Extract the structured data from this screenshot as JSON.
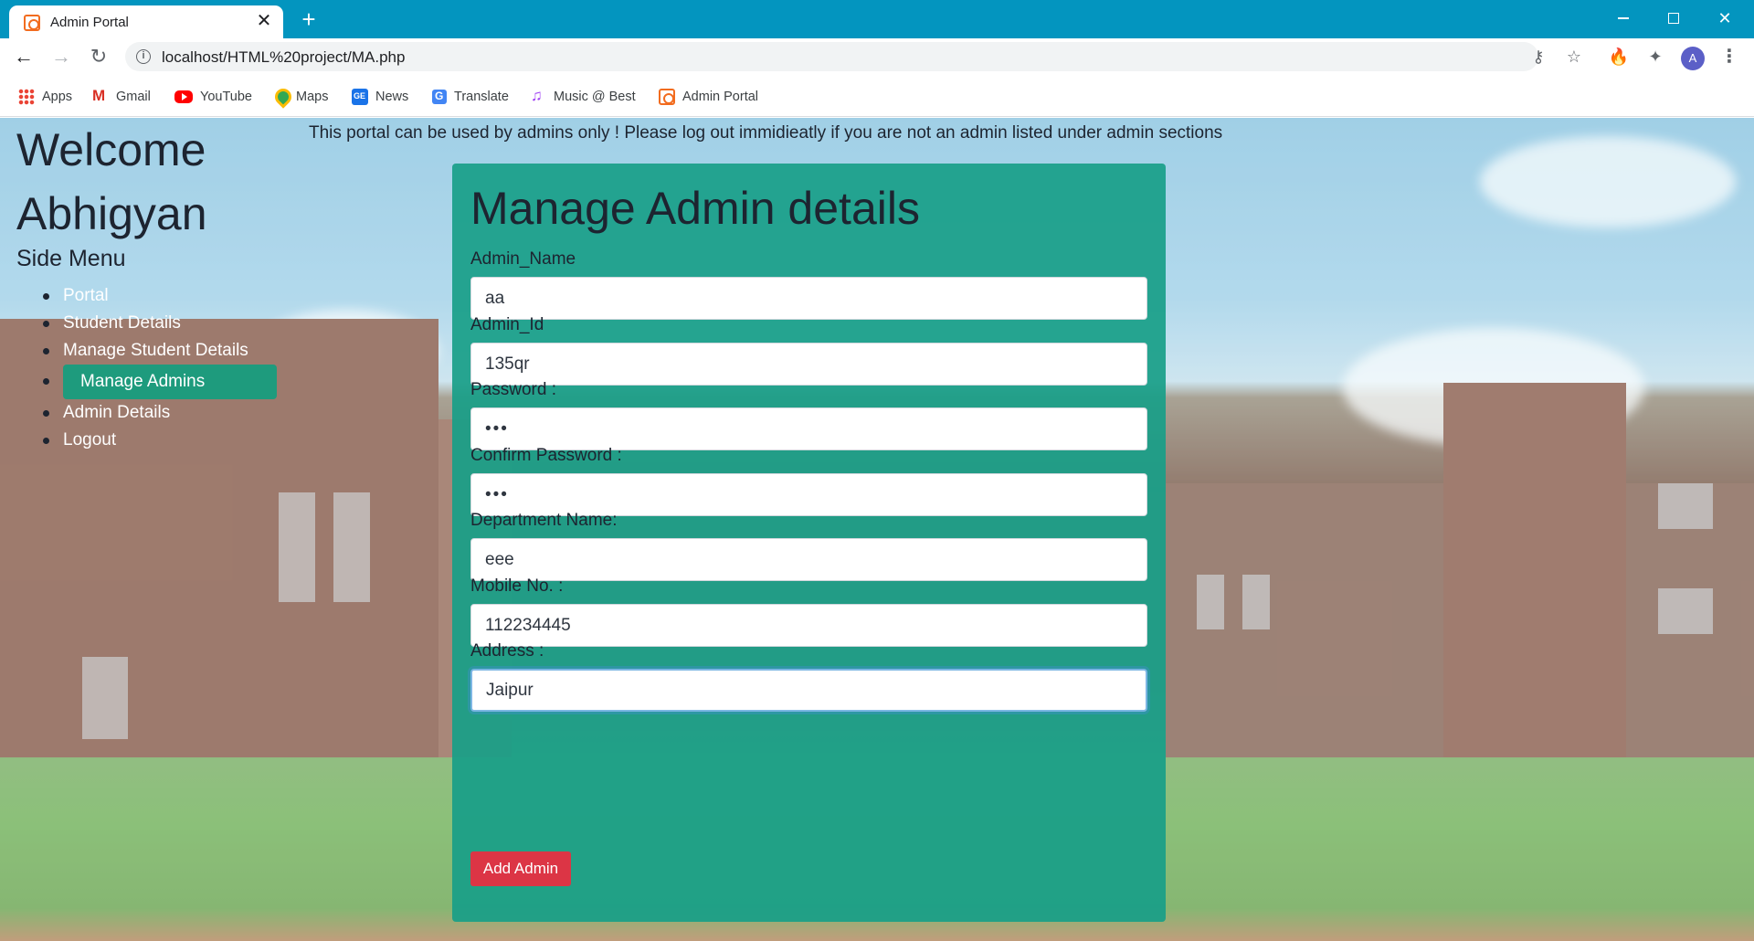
{
  "tab": {
    "title": "Admin Portal",
    "close_glyph": "✕"
  },
  "new_tab_glyph": "+",
  "window_controls": {
    "close_glyph": "✕"
  },
  "toolbar": {
    "back_glyph": "←",
    "forward_glyph": "→",
    "reload_glyph": "↻",
    "url": "localhost/HTML%20project/MA.php",
    "info_glyph": "i",
    "key_glyph": "⚷",
    "star_glyph": "☆",
    "fire_glyph": "🔥",
    "puzzle_glyph": "✦",
    "avatar_letter": "A",
    "menu_glyph": "⋮"
  },
  "bookmarks": [
    {
      "label": "Apps",
      "icon": "apps-icon"
    },
    {
      "label": "Gmail",
      "icon": "gmail-icon"
    },
    {
      "label": "YouTube",
      "icon": "youtube-icon"
    },
    {
      "label": "Maps",
      "icon": "maps-icon"
    },
    {
      "label": "News",
      "icon": "news-icon"
    },
    {
      "label": "Translate",
      "icon": "translate-icon"
    },
    {
      "label": "Music @ Best",
      "icon": "music-icon"
    },
    {
      "label": "Admin Portal",
      "icon": "xampp-icon"
    }
  ],
  "page": {
    "welcome_line1": "Welcome",
    "welcome_line2": "Abhigyan",
    "side_heading": "Side Menu",
    "side_menu": [
      {
        "label": "Portal"
      },
      {
        "label": "Student Details"
      },
      {
        "label": "Manage Student Details"
      },
      {
        "label": "Manage Admins",
        "active": true
      },
      {
        "label": "Admin Details"
      },
      {
        "label": "Logout"
      }
    ],
    "notice": "This portal can be used by admins only ! Please log out immidieatly if you are not an admin listed under admin sections"
  },
  "form": {
    "title": "Manage Admin details",
    "fields": [
      {
        "label": "Admin_Name",
        "value": "aa"
      },
      {
        "label": "Admin_Id",
        "value": "135qr"
      },
      {
        "label": "Password :",
        "value": "•••"
      },
      {
        "label": "Confirm Password :",
        "value": "•••"
      },
      {
        "label": "Department Name:",
        "value": "eee"
      },
      {
        "label": "Mobile No. :",
        "value": "112234445"
      },
      {
        "label": "Address :",
        "value": "Jaipur"
      }
    ],
    "submit_label": "Add Admin",
    "accent_color": "#189e88",
    "button_color": "#dc3545"
  }
}
